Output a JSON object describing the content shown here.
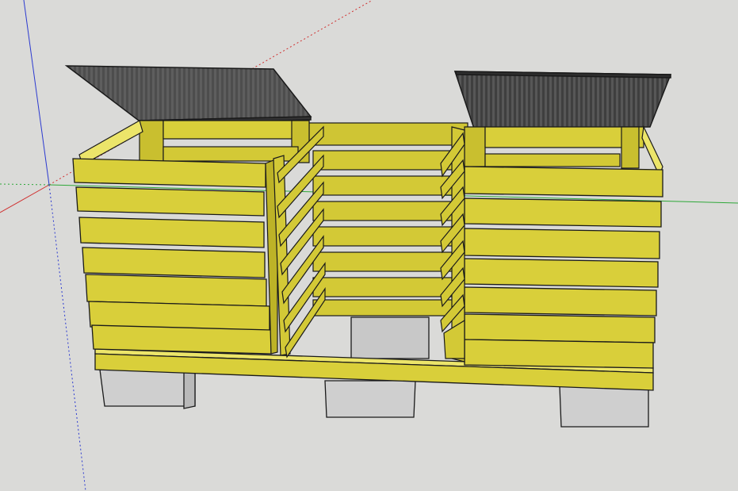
{
  "app": {
    "viewport_background": "#dadad8"
  },
  "model": {
    "subject": "",
    "colors": {
      "wood": "#d9cf3a",
      "wood_dark": "#b8ad23",
      "wood_top": "#ece56a",
      "outline": "#1a1a1a",
      "lid": "#4e4e4e",
      "lid_light": "#6a6a6a",
      "block": "#cfcfcf",
      "block_dark": "#b4b4b4"
    },
    "axes": {
      "red": "#d03030",
      "green": "#2fa83a",
      "blue": "#2c3ad0"
    }
  }
}
